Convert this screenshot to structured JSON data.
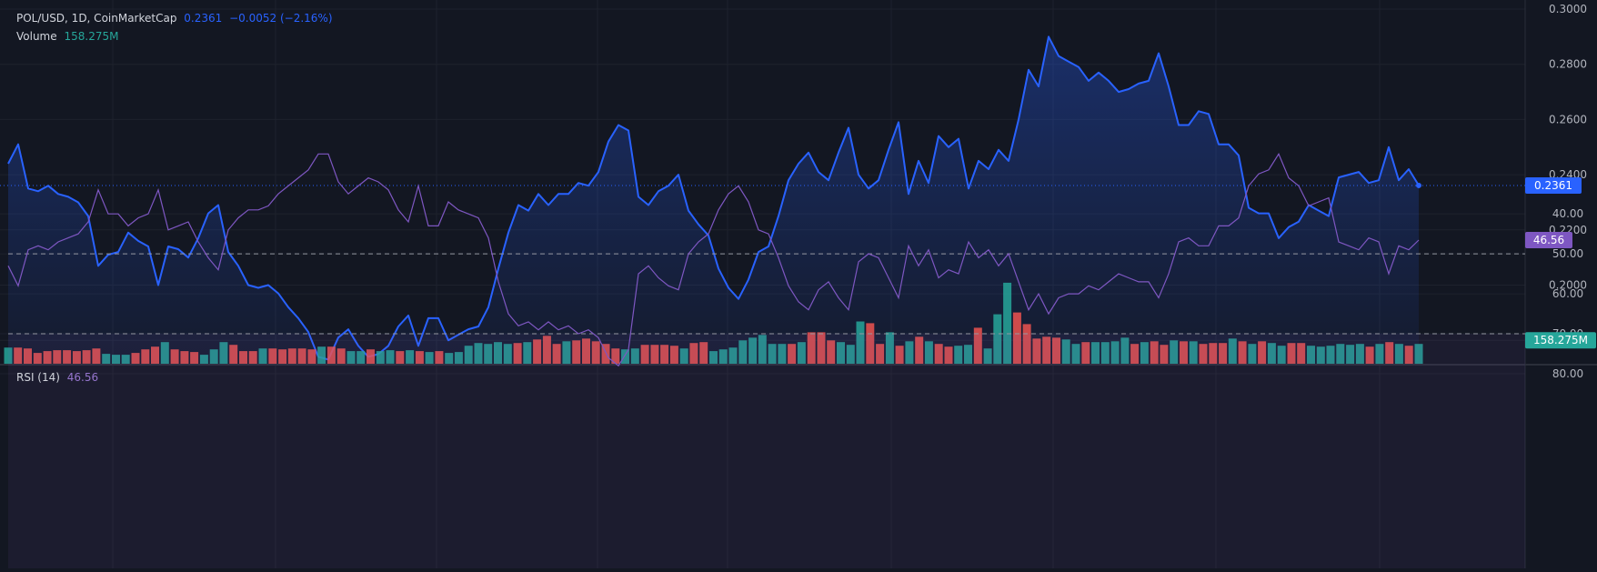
{
  "legend": {
    "symbol": "POL/USD, 1D, CoinMarketCap",
    "last": "0.2361",
    "change": "−0.0052 (−2.16%)",
    "volume_label": "Volume",
    "volume_value": "158.275M",
    "rsi_label": "RSI (14)",
    "rsi_value": "46.56"
  },
  "colors": {
    "background": "#131722",
    "grid": "#1e222d",
    "price_line": "#2962ff",
    "up_volume": "#26a69a",
    "down_volume": "#ef5350",
    "rsi_line": "#7e57c2",
    "rsi_band": "#7e57c2"
  },
  "chart_data": [
    {
      "type": "area",
      "price_ticks": [
        "0.3000",
        "0.2800",
        "0.2600",
        "0.2400",
        "0.2200",
        "0.2000",
        "0.1800"
      ],
      "ylim": [
        0.1715,
        0.3
      ],
      "last_price": 0.2361,
      "last_price_label": "0.2361",
      "volume_label": "158.275M",
      "grid": true,
      "series": [
        {
          "values": [
            0.244,
            0.251,
            0.235,
            0.234,
            0.236,
            0.233,
            0.232,
            0.23,
            0.225,
            0.207,
            0.211,
            0.212,
            0.219,
            0.216,
            0.214,
            0.2,
            0.214,
            0.213,
            0.21,
            0.217,
            0.226,
            0.229,
            0.212,
            0.207,
            0.2,
            0.199,
            0.2,
            0.197,
            0.192,
            0.188,
            0.183,
            0.174,
            0.173,
            0.181,
            0.184,
            0.178,
            0.174,
            0.175,
            0.178,
            0.185,
            0.189,
            0.178,
            0.188,
            0.188,
            0.18,
            0.182,
            0.184,
            0.185,
            0.192,
            0.206,
            0.219,
            0.229,
            0.227,
            0.233,
            0.229,
            0.233,
            0.233,
            0.237,
            0.236,
            0.241,
            0.252,
            0.258,
            0.256,
            0.232,
            0.229,
            0.234,
            0.236,
            0.24,
            0.227,
            0.222,
            0.218,
            0.206,
            0.199,
            0.195,
            0.202,
            0.212,
            0.214,
            0.225,
            0.238,
            0.244,
            0.248,
            0.241,
            0.238,
            0.248,
            0.257,
            0.24,
            0.235,
            0.238,
            0.249,
            0.259,
            0.233,
            0.245,
            0.237,
            0.254,
            0.25,
            0.253,
            0.235,
            0.245,
            0.242,
            0.249,
            0.245,
            0.26,
            0.278,
            0.272,
            0.29,
            0.283,
            0.281,
            0.279,
            0.274,
            0.277,
            0.274,
            0.27,
            0.271,
            0.273,
            0.274,
            0.284,
            0.272,
            0.258,
            0.258,
            0.263,
            0.262,
            0.251,
            0.251,
            0.247,
            0.228,
            0.226,
            0.226,
            0.217,
            0.221,
            0.223,
            0.229,
            0.227,
            0.225,
            0.239,
            0.24,
            0.241,
            0.237,
            0.238,
            0.25,
            0.238,
            0.242,
            0.2361
          ]
        }
      ]
    },
    {
      "type": "bar",
      "ylim": [
        0,
        100
      ],
      "series": [
        {
          "values": [
            18,
            18,
            17,
            12,
            14,
            15,
            15,
            14,
            15,
            17,
            11,
            10,
            10,
            12,
            16,
            19,
            24,
            16,
            14,
            13,
            10,
            16,
            24,
            21,
            14,
            14,
            17,
            17,
            16,
            17,
            17,
            16,
            19,
            19,
            17,
            14,
            14,
            16,
            14,
            15,
            14,
            15,
            14,
            13,
            14,
            12,
            13,
            20,
            23,
            22,
            24,
            22,
            23,
            24,
            27,
            31,
            22,
            25,
            26,
            28,
            25,
            22,
            17,
            16,
            17,
            21,
            21,
            21,
            20,
            17,
            23,
            24,
            14,
            16,
            18,
            26,
            29,
            32,
            22,
            22,
            22,
            24,
            35,
            35,
            26,
            24,
            21,
            47,
            45,
            22,
            35,
            20,
            25,
            30,
            25,
            22,
            19,
            20,
            21,
            40,
            17,
            55,
            90,
            57,
            44,
            28,
            30,
            29,
            27,
            22,
            24,
            24,
            24,
            25,
            29,
            22,
            24,
            25,
            21,
            26,
            25,
            25,
            22,
            23,
            23,
            28,
            25,
            22,
            25,
            23,
            20,
            23,
            23,
            20,
            19,
            20,
            22,
            21,
            22,
            19,
            22,
            24,
            22,
            20,
            22
          ],
          "colors": [
            "up",
            "down",
            "down",
            "down",
            "down",
            "down",
            "down",
            "down",
            "down",
            "down",
            "up",
            "up",
            "up",
            "down",
            "down",
            "down",
            "up",
            "down",
            "down",
            "down",
            "up",
            "up",
            "up",
            "down",
            "down",
            "down",
            "up",
            "down",
            "down",
            "down",
            "down",
            "down",
            "up",
            "down",
            "down",
            "up",
            "up",
            "down",
            "up",
            "up",
            "down",
            "up",
            "down",
            "up",
            "down",
            "up",
            "up",
            "up",
            "up",
            "up",
            "up",
            "up",
            "down",
            "up",
            "down",
            "down",
            "down",
            "up",
            "down",
            "down",
            "down",
            "down",
            "down",
            "up",
            "up",
            "down",
            "down",
            "down",
            "down",
            "up",
            "down",
            "down",
            "up",
            "up",
            "up",
            "up",
            "up",
            "up",
            "up",
            "up",
            "down",
            "up",
            "down",
            "down",
            "down",
            "up",
            "up",
            "up",
            "down",
            "down",
            "up",
            "down",
            "up",
            "down",
            "up",
            "down",
            "down",
            "up",
            "up",
            "down",
            "up",
            "up",
            "up",
            "down",
            "down",
            "down",
            "down",
            "down",
            "up",
            "up",
            "down",
            "up",
            "up",
            "up",
            "up",
            "down",
            "up",
            "down",
            "down",
            "up",
            "down",
            "up",
            "down",
            "down",
            "down",
            "up",
            "down",
            "up",
            "down",
            "up",
            "up",
            "down",
            "down",
            "up",
            "up",
            "up",
            "up",
            "up",
            "up",
            "down",
            "up",
            "down",
            "up",
            "down",
            "up"
          ]
        }
      ]
    },
    {
      "type": "line",
      "yticks": [
        "80.00",
        "70.00",
        "60.00",
        "50.00",
        "40.00"
      ],
      "ylim": [
        37,
        80
      ],
      "bands": [
        70,
        50
      ],
      "last_value": 46.56,
      "last_label": "46.56",
      "series": [
        {
          "values": [
            53,
            58,
            49,
            48,
            49,
            47,
            46,
            45,
            42,
            34,
            40,
            40,
            43,
            41,
            40,
            34,
            44,
            43,
            42,
            47,
            51,
            54,
            44,
            41,
            39,
            39,
            38,
            35,
            33,
            31,
            29,
            25,
            25,
            32,
            35,
            33,
            31,
            32,
            34,
            39,
            42,
            33,
            43,
            43,
            37,
            39,
            40,
            41,
            46,
            57,
            65,
            68,
            67,
            69,
            67,
            69,
            68,
            70,
            69,
            71,
            76,
            78,
            74,
            55,
            53,
            56,
            58,
            59,
            50,
            47,
            45,
            39,
            35,
            33,
            37,
            44,
            45,
            51,
            58,
            62,
            64,
            59,
            57,
            61,
            64,
            52,
            50,
            51,
            56,
            61,
            48,
            53,
            49,
            56,
            54,
            55,
            47,
            51,
            49,
            53,
            50,
            57,
            64,
            60,
            65,
            61,
            60,
            60,
            58,
            59,
            57,
            55,
            56,
            57,
            57,
            61,
            55,
            47,
            46,
            48,
            48,
            43,
            43,
            41,
            33,
            30,
            29,
            25,
            31,
            33,
            38,
            37,
            36,
            47,
            48,
            49,
            46,
            47,
            55,
            48,
            49,
            46.56
          ]
        }
      ]
    }
  ]
}
